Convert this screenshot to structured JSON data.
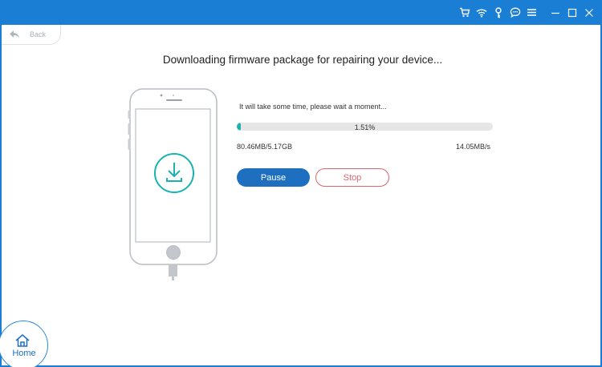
{
  "window": {
    "titlebar_icons": [
      "cart-icon",
      "wifi-icon",
      "key-icon",
      "feedback-icon",
      "menu-icon",
      "minimize-icon",
      "maximize-icon",
      "close-icon"
    ],
    "colors": {
      "titlebar": "#1a7fd4",
      "accent": "#1f6fc0",
      "progress": "#1ab2b0",
      "stop": "#e0646b"
    }
  },
  "nav": {
    "back_label": "Back"
  },
  "main": {
    "headline": "Downloading firmware package for repairing your device...",
    "wait_message": "It will take some time, please wait a moment...",
    "progress": {
      "percent_label": "1.51%",
      "fraction": 0.0151
    },
    "downloaded": "80.46MB/5.17GB",
    "speed": "14.05MB/s",
    "pause_label": "Pause",
    "stop_label": "Stop"
  },
  "home": {
    "label": "Home"
  }
}
